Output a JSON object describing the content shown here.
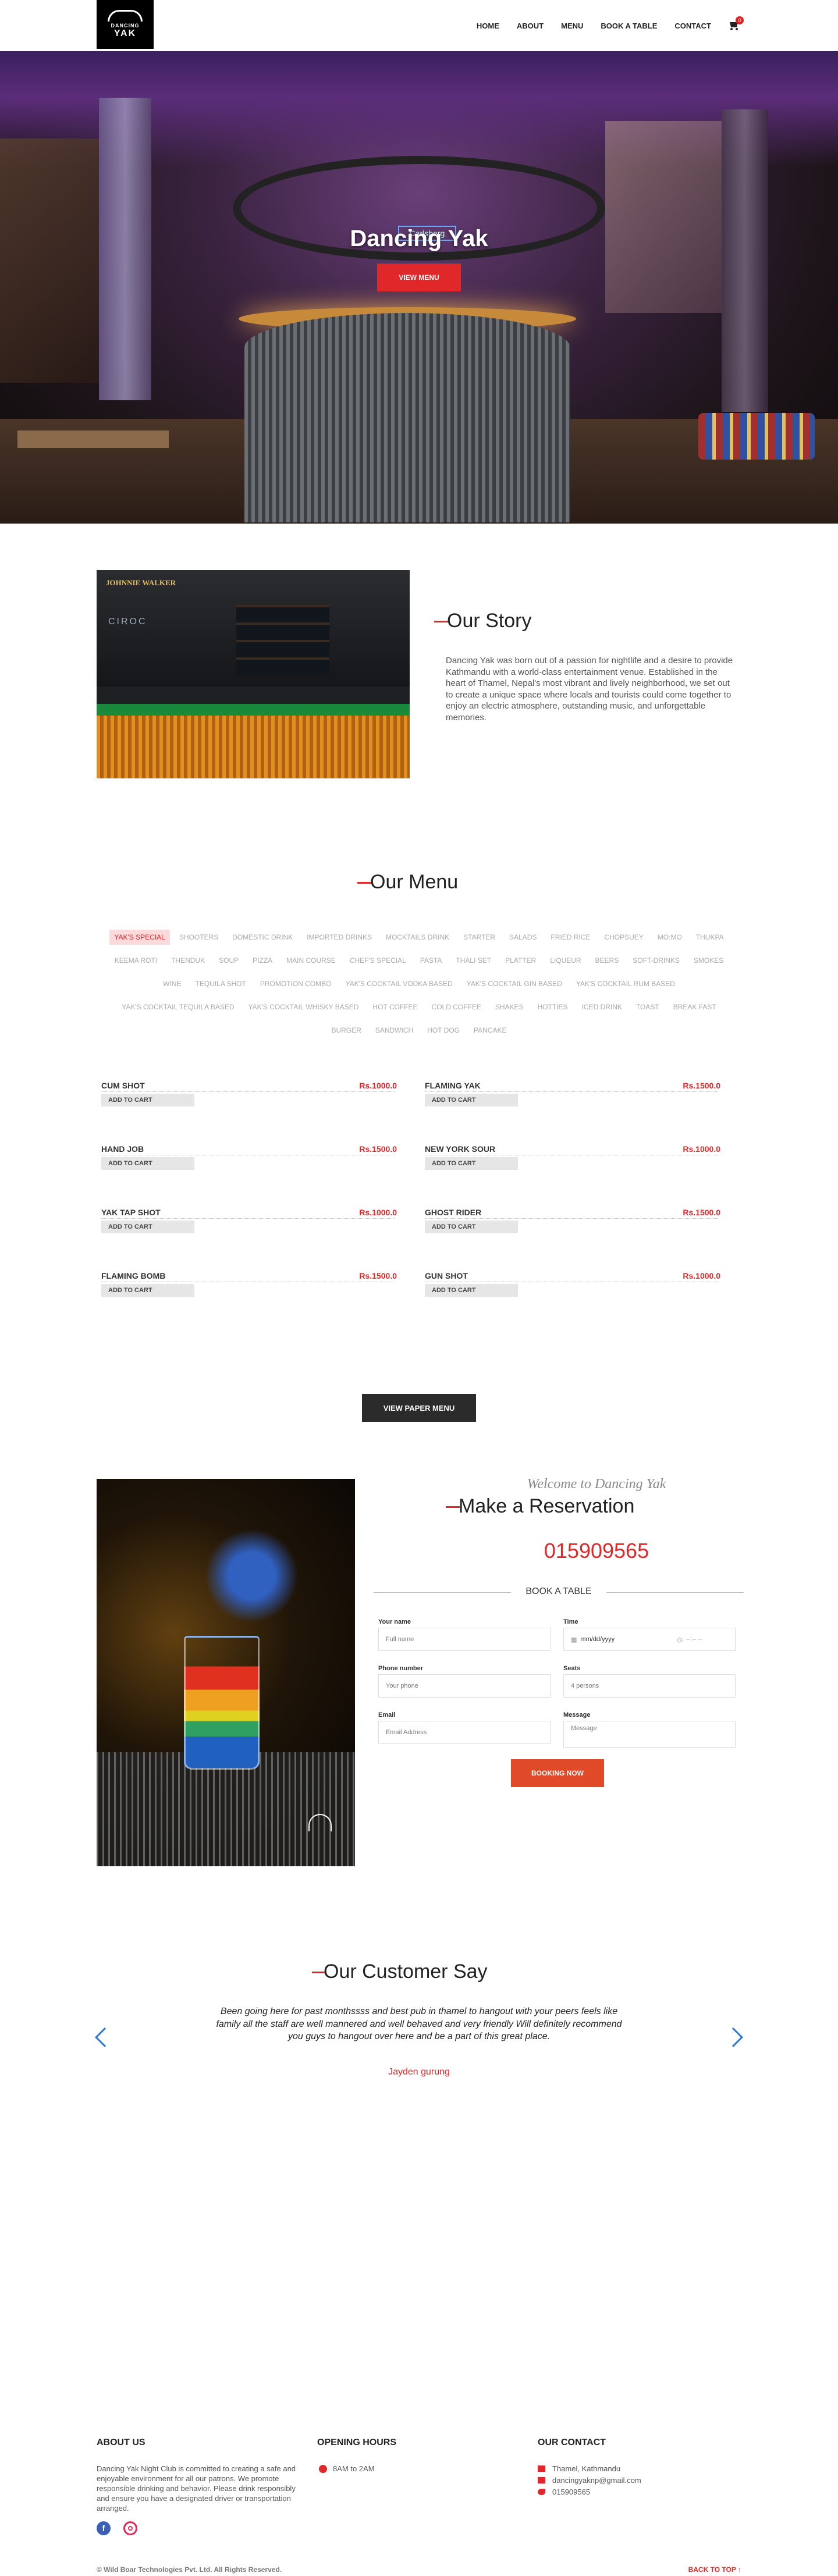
{
  "nav": {
    "logo_line1": "DANCING",
    "logo_line2": "YAK",
    "items": [
      "HOME",
      "ABOUT",
      "MENU",
      "BOOK A TABLE",
      "CONTACT"
    ],
    "cart_count": "0"
  },
  "hero": {
    "title": "Dancing Yak",
    "button": "VIEW MENU",
    "sign_text": "Carlsberg"
  },
  "story": {
    "title": "Our Story",
    "text": "Dancing Yak was born out of a passion for nightlife and a desire to provide Kathmandu with a world-class entertainment venue. Established in the heart of Thamel, Nepal's most vibrant and lively neighborhood, we set out to create a unique space where locals and tourists could come together to enjoy an electric atmosphere, outstanding music, and unforgettable memories."
  },
  "menu": {
    "title": "Our Menu",
    "categories": [
      "YAK'S SPECIAL",
      "SHOOTERS",
      "DOMESTIC DRINK",
      "IMPORTED DRINKS",
      "MOCKTAILS DRINK",
      "STARTER",
      "SALADS",
      "FRIED RICE",
      "CHOPSUEY",
      "MO:MO",
      "THUKPA",
      "KEEMA ROTI",
      "THENDUK",
      "SOUP",
      "PIZZA",
      "MAIN COURSE",
      "CHEF'S SPECIAL",
      "PASTA",
      "THALI SET",
      "PLATTER",
      "LIQUEUR",
      "BEERS",
      "SOFT-DRINKS",
      "SMOKES",
      "WINE",
      "TEQUILA SHOT",
      "PROMOTION COMBO",
      "YAK'S COCKTAIL VODKA BASED",
      "YAK'S COCKTAIL GIN BASED",
      "YAK'S COCKTAIL RUM BASED",
      "YAK'S COCKTAIL TEQUILA BASED",
      "YAK'S COCKTAIL WHISKY BASED",
      "HOT COFFEE",
      "COLD COFFEE",
      "SHAKES",
      "HOTTIES",
      "ICED DRINK",
      "TOAST",
      "BREAK FAST",
      "BURGER",
      "SANDWICH",
      "HOT DOG",
      "PANCAKE"
    ],
    "items": [
      {
        "name": "CUM SHOT",
        "price": "Rs.1000.0"
      },
      {
        "name": "FLAMING YAK",
        "price": "Rs.1500.0"
      },
      {
        "name": "HAND JOB",
        "price": "Rs.1500.0"
      },
      {
        "name": "NEW YORK SOUR",
        "price": "Rs.1000.0"
      },
      {
        "name": "YAK TAP SHOT",
        "price": "Rs.1000.0"
      },
      {
        "name": "GHOST RIDER",
        "price": "Rs.1500.0"
      },
      {
        "name": "FLAMING BOMB",
        "price": "Rs.1500.0"
      },
      {
        "name": "GUN SHOT",
        "price": "Rs.1000.0"
      }
    ],
    "add_to_cart": "ADD TO CART",
    "paper_menu": "VIEW PAPER MENU"
  },
  "reservation": {
    "welcome": "Welcome to Dancing Yak",
    "title": "Make a Reservation",
    "phone": "015909565",
    "book_heading": "BOOK A TABLE",
    "name_label": "Your name",
    "name_placeholder": "Full name",
    "time_label": "Time",
    "date_placeholder": "mm/dd/yyyy",
    "time_placeholder": "--:-- --",
    "phone_label": "Phone number",
    "phone_placeholder": "Your phone",
    "seats_label": "Seats",
    "seats_value": "4 persons",
    "email_label": "Email",
    "email_placeholder": "Email Address",
    "message_label": "Message",
    "message_placeholder": "Message",
    "submit": "BOOKING NOW"
  },
  "testimonial": {
    "title": "Our Customer Say",
    "quote": "Been going here for past monthssss and best pub in thamel to hangout with your peers feels like family all the staff are well mannered and well behaved and very friendly Will definitely recommend you guys to hangout over here and be a part of this great place.",
    "author": "Jayden gurung"
  },
  "footer": {
    "about_title": "ABOUT US",
    "about_text": "Dancing Yak Night Club is committed to creating a safe and enjoyable environment for all our patrons. We promote responsible drinking and behavior. Please drink responsibly and ensure you have a designated driver or transportation arranged.",
    "hours_title": "OPENING HOURS",
    "hours": "8AM to 2AM",
    "contact_title": "OUR CONTACT",
    "address": "Thamel, Kathmandu",
    "email": "dancingyaknp@gmail.com",
    "phone": "015909565",
    "copyright": "© Wild Boar Technologies Pvt. Ltd. All Rights Reserved.",
    "back_to_top": "BACK TO TOP ↑"
  }
}
